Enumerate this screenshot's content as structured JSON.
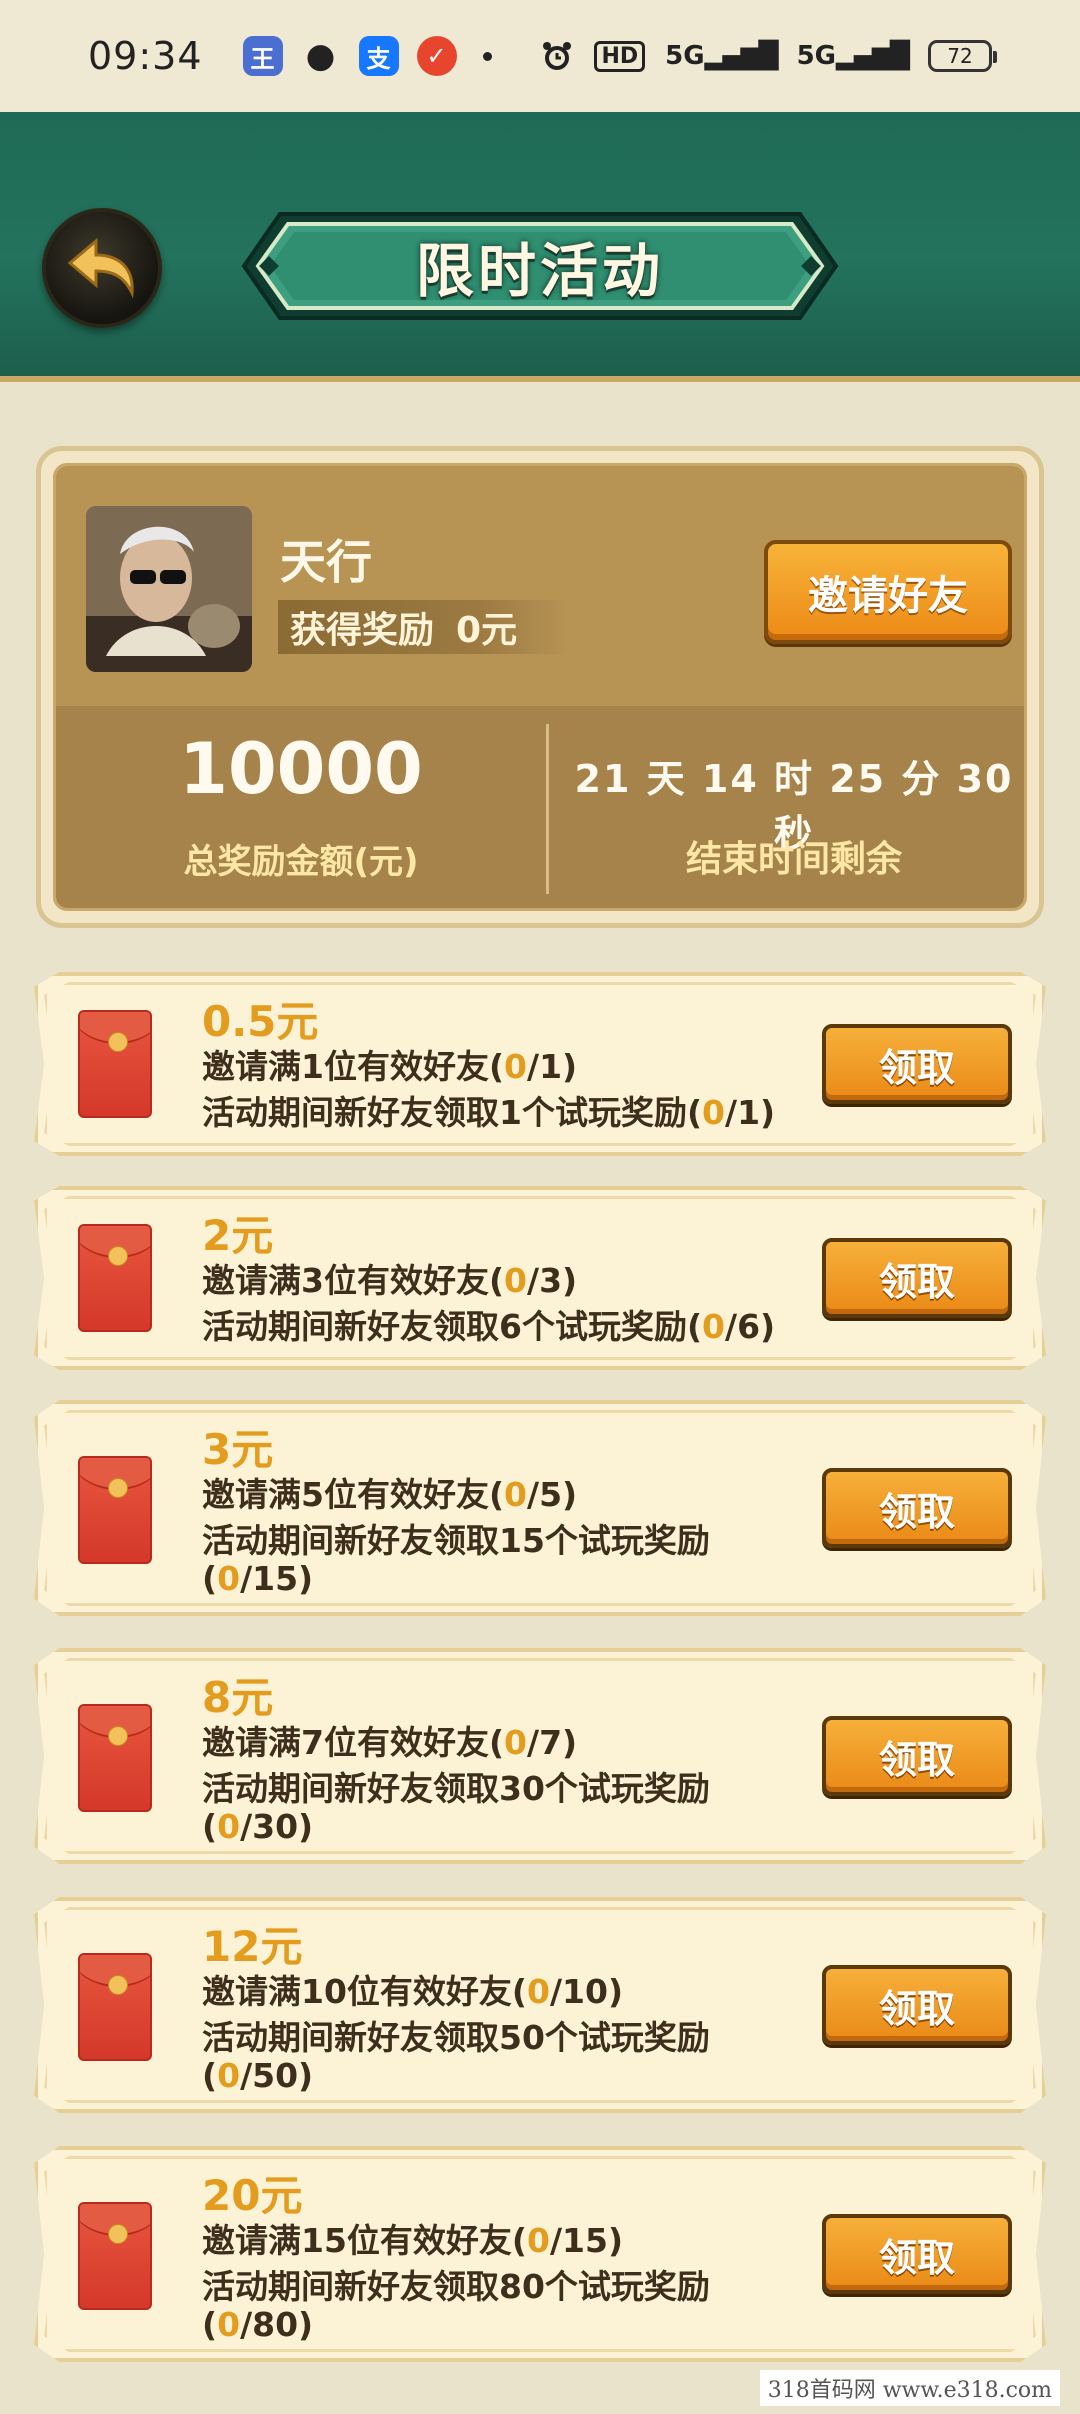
{
  "status_bar": {
    "time": "09:34",
    "apps": [
      {
        "icon": "app-icon-blue",
        "glyph": "王",
        "color": "#4b6fd0"
      },
      {
        "icon": "wechat-icon",
        "glyph": "●",
        "color": "#222222"
      },
      {
        "icon": "alipay-icon",
        "glyph": "支",
        "color": "#1677ff"
      },
      {
        "icon": "app-icon-red",
        "glyph": "✓",
        "color": "#e8452f"
      }
    ],
    "hd_label": "HD",
    "signal_1": "5G",
    "signal_2": "5G",
    "battery": "72"
  },
  "header": {
    "title": "限时活动"
  },
  "profile": {
    "name": "天行",
    "reward_label": "获得奖励",
    "reward_value": "0元",
    "invite_button": "邀请好友",
    "total_amount": "10000",
    "total_label": "总奖励金额(元)",
    "countdown": "21 天 14 时 25 分 30 秒",
    "countdown_label": "结束时间剩余"
  },
  "tasks": [
    {
      "amount": "0.5元",
      "line1_pre": "邀请满1位有效好友(",
      "line1_prog": "0",
      "line1_post": "/1)",
      "line2_pre": "活动期间新好友领取1个试玩奖励(",
      "line2_prog": "0",
      "line2_post": "/1)",
      "button": "领取"
    },
    {
      "amount": "2元",
      "line1_pre": "邀请满3位有效好友(",
      "line1_prog": "0",
      "line1_post": "/3)",
      "line2_pre": "活动期间新好友领取6个试玩奖励(",
      "line2_prog": "0",
      "line2_post": "/6)",
      "button": "领取"
    },
    {
      "amount": "3元",
      "line1_pre": "邀请满5位有效好友(",
      "line1_prog": "0",
      "line1_post": "/5)",
      "line2_pre": "活动期间新好友领取15个试玩奖励(",
      "line2_prog": "0",
      "line2_post": "/15)",
      "button": "领取"
    },
    {
      "amount": "8元",
      "line1_pre": "邀请满7位有效好友(",
      "line1_prog": "0",
      "line1_post": "/7)",
      "line2_pre": "活动期间新好友领取30个试玩奖励(",
      "line2_prog": "0",
      "line2_post": "/30)",
      "button": "领取"
    },
    {
      "amount": "12元",
      "line1_pre": "邀请满10位有效好友(",
      "line1_prog": "0",
      "line1_post": "/10)",
      "line2_pre": "活动期间新好友领取50个试玩奖励(",
      "line2_prog": "0",
      "line2_post": "/50)",
      "button": "领取"
    },
    {
      "amount": "20元",
      "line1_pre": "邀请满15位有效好友(",
      "line1_prog": "0",
      "line1_post": "/15)",
      "line2_pre": "活动期间新好友领取80个试玩奖励(",
      "line2_prog": "0",
      "line2_post": "/80)",
      "button": "领取"
    }
  ],
  "watermark": "318首码网  www.e318.com"
}
